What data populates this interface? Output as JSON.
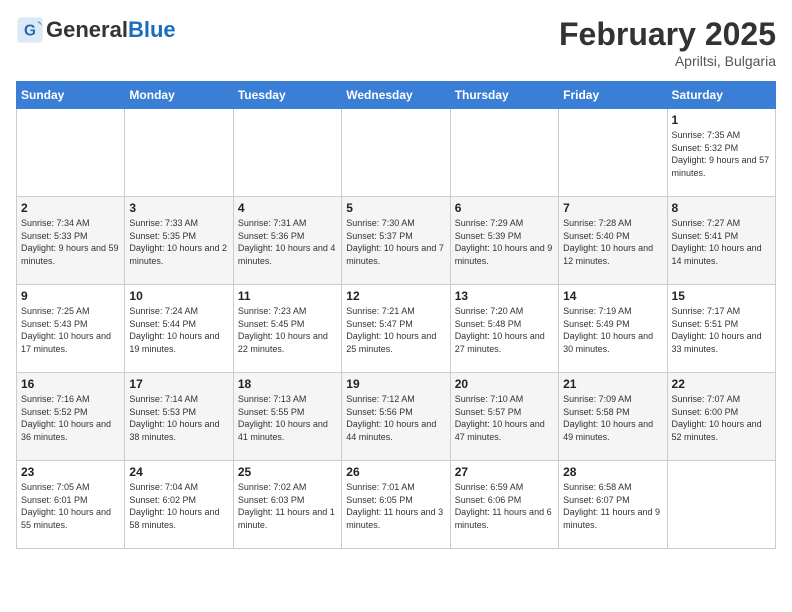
{
  "header": {
    "logo_general": "General",
    "logo_blue": "Blue",
    "month": "February 2025",
    "location": "Apriltsi, Bulgaria"
  },
  "days_of_week": [
    "Sunday",
    "Monday",
    "Tuesday",
    "Wednesday",
    "Thursday",
    "Friday",
    "Saturday"
  ],
  "weeks": [
    [
      {
        "day": "",
        "info": ""
      },
      {
        "day": "",
        "info": ""
      },
      {
        "day": "",
        "info": ""
      },
      {
        "day": "",
        "info": ""
      },
      {
        "day": "",
        "info": ""
      },
      {
        "day": "",
        "info": ""
      },
      {
        "day": "1",
        "info": "Sunrise: 7:35 AM\nSunset: 5:32 PM\nDaylight: 9 hours and 57 minutes."
      }
    ],
    [
      {
        "day": "2",
        "info": "Sunrise: 7:34 AM\nSunset: 5:33 PM\nDaylight: 9 hours and 59 minutes."
      },
      {
        "day": "3",
        "info": "Sunrise: 7:33 AM\nSunset: 5:35 PM\nDaylight: 10 hours and 2 minutes."
      },
      {
        "day": "4",
        "info": "Sunrise: 7:31 AM\nSunset: 5:36 PM\nDaylight: 10 hours and 4 minutes."
      },
      {
        "day": "5",
        "info": "Sunrise: 7:30 AM\nSunset: 5:37 PM\nDaylight: 10 hours and 7 minutes."
      },
      {
        "day": "6",
        "info": "Sunrise: 7:29 AM\nSunset: 5:39 PM\nDaylight: 10 hours and 9 minutes."
      },
      {
        "day": "7",
        "info": "Sunrise: 7:28 AM\nSunset: 5:40 PM\nDaylight: 10 hours and 12 minutes."
      },
      {
        "day": "8",
        "info": "Sunrise: 7:27 AM\nSunset: 5:41 PM\nDaylight: 10 hours and 14 minutes."
      }
    ],
    [
      {
        "day": "9",
        "info": "Sunrise: 7:25 AM\nSunset: 5:43 PM\nDaylight: 10 hours and 17 minutes."
      },
      {
        "day": "10",
        "info": "Sunrise: 7:24 AM\nSunset: 5:44 PM\nDaylight: 10 hours and 19 minutes."
      },
      {
        "day": "11",
        "info": "Sunrise: 7:23 AM\nSunset: 5:45 PM\nDaylight: 10 hours and 22 minutes."
      },
      {
        "day": "12",
        "info": "Sunrise: 7:21 AM\nSunset: 5:47 PM\nDaylight: 10 hours and 25 minutes."
      },
      {
        "day": "13",
        "info": "Sunrise: 7:20 AM\nSunset: 5:48 PM\nDaylight: 10 hours and 27 minutes."
      },
      {
        "day": "14",
        "info": "Sunrise: 7:19 AM\nSunset: 5:49 PM\nDaylight: 10 hours and 30 minutes."
      },
      {
        "day": "15",
        "info": "Sunrise: 7:17 AM\nSunset: 5:51 PM\nDaylight: 10 hours and 33 minutes."
      }
    ],
    [
      {
        "day": "16",
        "info": "Sunrise: 7:16 AM\nSunset: 5:52 PM\nDaylight: 10 hours and 36 minutes."
      },
      {
        "day": "17",
        "info": "Sunrise: 7:14 AM\nSunset: 5:53 PM\nDaylight: 10 hours and 38 minutes."
      },
      {
        "day": "18",
        "info": "Sunrise: 7:13 AM\nSunset: 5:55 PM\nDaylight: 10 hours and 41 minutes."
      },
      {
        "day": "19",
        "info": "Sunrise: 7:12 AM\nSunset: 5:56 PM\nDaylight: 10 hours and 44 minutes."
      },
      {
        "day": "20",
        "info": "Sunrise: 7:10 AM\nSunset: 5:57 PM\nDaylight: 10 hours and 47 minutes."
      },
      {
        "day": "21",
        "info": "Sunrise: 7:09 AM\nSunset: 5:58 PM\nDaylight: 10 hours and 49 minutes."
      },
      {
        "day": "22",
        "info": "Sunrise: 7:07 AM\nSunset: 6:00 PM\nDaylight: 10 hours and 52 minutes."
      }
    ],
    [
      {
        "day": "23",
        "info": "Sunrise: 7:05 AM\nSunset: 6:01 PM\nDaylight: 10 hours and 55 minutes."
      },
      {
        "day": "24",
        "info": "Sunrise: 7:04 AM\nSunset: 6:02 PM\nDaylight: 10 hours and 58 minutes."
      },
      {
        "day": "25",
        "info": "Sunrise: 7:02 AM\nSunset: 6:03 PM\nDaylight: 11 hours and 1 minute."
      },
      {
        "day": "26",
        "info": "Sunrise: 7:01 AM\nSunset: 6:05 PM\nDaylight: 11 hours and 3 minutes."
      },
      {
        "day": "27",
        "info": "Sunrise: 6:59 AM\nSunset: 6:06 PM\nDaylight: 11 hours and 6 minutes."
      },
      {
        "day": "28",
        "info": "Sunrise: 6:58 AM\nSunset: 6:07 PM\nDaylight: 11 hours and 9 minutes."
      },
      {
        "day": "",
        "info": ""
      }
    ]
  ]
}
